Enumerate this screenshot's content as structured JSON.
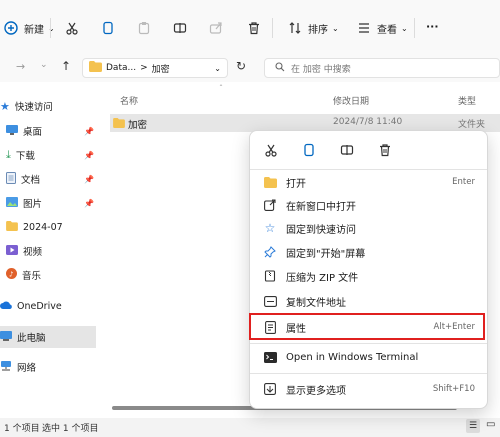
{
  "toolbar": {
    "new_label": "新建",
    "sort_label": "排序",
    "view_label": "查看",
    "more_label": "···"
  },
  "nav": {
    "path_parent": "Data...",
    "path_sep": ">",
    "path_current": "加密",
    "search_placeholder": "在 加密 中搜索"
  },
  "sidebar": {
    "items": [
      {
        "label": "快速访问",
        "icon": "star-icon"
      },
      {
        "label": "桌面",
        "icon": "desktop-icon"
      },
      {
        "label": "下载",
        "icon": "download-icon"
      },
      {
        "label": "文档",
        "icon": "document-icon"
      },
      {
        "label": "图片",
        "icon": "picture-icon"
      },
      {
        "label": "2024-07",
        "icon": "folder-icon"
      },
      {
        "label": "视频",
        "icon": "video-icon"
      },
      {
        "label": "音乐",
        "icon": "music-icon"
      },
      {
        "label": "OneDrive",
        "icon": "cloud-icon"
      },
      {
        "label": "此电脑",
        "icon": "computer-icon"
      },
      {
        "label": "网络",
        "icon": "network-icon"
      }
    ]
  },
  "columns": {
    "name": "名称",
    "modified": "修改日期",
    "type": "类型"
  },
  "file": {
    "name": "加密",
    "modified": "2024/7/8 11:40",
    "type": "文件夹"
  },
  "status": {
    "count": "1 个项目",
    "selected": "选中 1 个项目"
  },
  "context_menu": {
    "items": [
      {
        "label": "打开",
        "shortcut": "Enter",
        "icon": "folder-open-icon"
      },
      {
        "label": "在新窗口中打开",
        "shortcut": "",
        "icon": "new-window-icon"
      },
      {
        "label": "固定到快速访问",
        "shortcut": "",
        "icon": "star-outline-icon"
      },
      {
        "label": "固定到\"开始\"屏幕",
        "shortcut": "",
        "icon": "pin-icon"
      },
      {
        "label": "压缩为 ZIP 文件",
        "shortcut": "",
        "icon": "zip-icon"
      },
      {
        "label": "复制文件地址",
        "shortcut": "",
        "icon": "copy-path-icon"
      },
      {
        "label": "属性",
        "shortcut": "Alt+Enter",
        "icon": "properties-icon"
      },
      {
        "label": "Open in Windows Terminal",
        "shortcut": "",
        "icon": "terminal-icon"
      },
      {
        "label": "显示更多选项",
        "shortcut": "Shift+F10",
        "icon": "more-options-icon"
      }
    ]
  },
  "colors": {
    "highlight": "#e0201f",
    "folder": "#f4c24f",
    "accent": "#0067c0"
  }
}
